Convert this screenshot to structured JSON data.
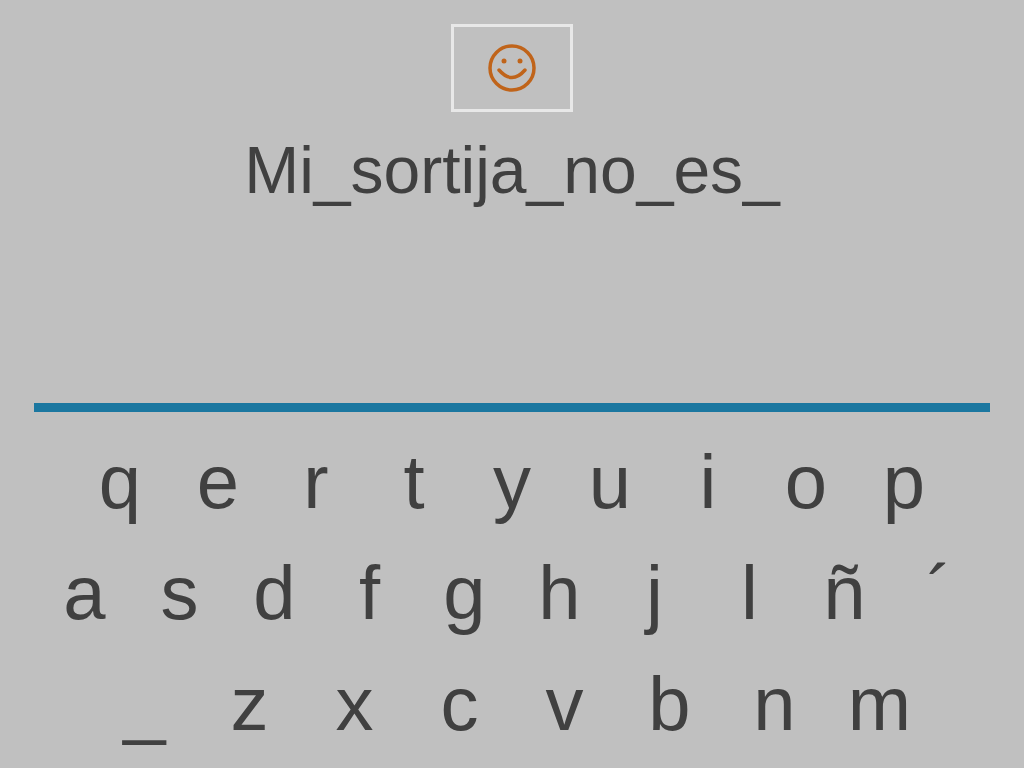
{
  "phrase": "Mi_sortija_no_es_",
  "keyboard": {
    "rows": [
      [
        "q",
        "e",
        "r",
        "t",
        "y",
        "u",
        "i",
        "o",
        "p"
      ],
      [
        "a",
        "s",
        "d",
        "f",
        "g",
        "h",
        "j",
        "l",
        "ñ",
        "´"
      ],
      [
        "_",
        "z",
        "x",
        "c",
        "v",
        "b",
        "n",
        "m"
      ]
    ]
  }
}
